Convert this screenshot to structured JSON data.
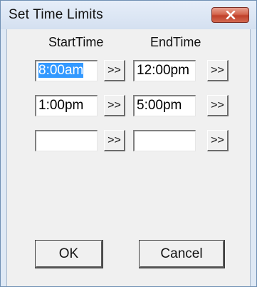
{
  "window": {
    "title": "Set Time Limits",
    "close_icon": "close-icon",
    "close_color": "#c7412b"
  },
  "columns": {
    "start_header": "StartTime",
    "end_header": "EndTime"
  },
  "rows": [
    {
      "start": "8:00am",
      "end": "12:00pm"
    },
    {
      "start": "1:00pm",
      "end": "5:00pm"
    },
    {
      "start": "",
      "end": ""
    }
  ],
  "picker_label": ">>",
  "buttons": {
    "ok": "OK",
    "cancel": "Cancel"
  },
  "selection_color": "#3399ff"
}
